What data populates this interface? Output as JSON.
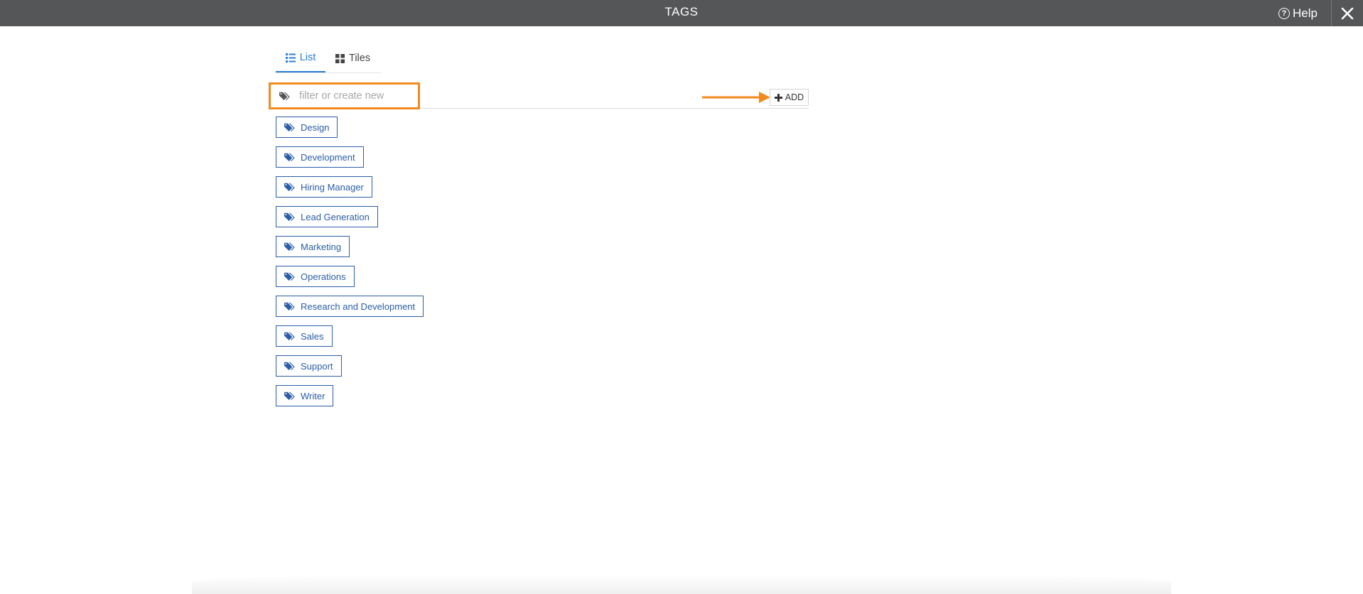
{
  "header": {
    "title": "TAGS",
    "help_label": "Help",
    "help_icon": "question-circle-icon",
    "close_icon": "close-icon"
  },
  "tabs": [
    {
      "label": "List",
      "icon": "list-icon",
      "active": true
    },
    {
      "label": "Tiles",
      "icon": "grid-icon",
      "active": false
    }
  ],
  "filter": {
    "placeholder": "filter or create new",
    "value": "",
    "icon": "tags-icon"
  },
  "add_button": {
    "label": "ADD",
    "icon": "plus-icon"
  },
  "tags": [
    {
      "label": "Design"
    },
    {
      "label": "Development"
    },
    {
      "label": "Hiring Manager"
    },
    {
      "label": "Lead Generation"
    },
    {
      "label": "Marketing"
    },
    {
      "label": "Operations"
    },
    {
      "label": "Research and Development"
    },
    {
      "label": "Sales"
    },
    {
      "label": "Support"
    },
    {
      "label": "Writer"
    }
  ],
  "colors": {
    "header_bg": "#555657",
    "accent_blue": "#2b7fd6",
    "tag_blue": "#2a5ea6",
    "highlight_orange": "#f28a1e"
  }
}
